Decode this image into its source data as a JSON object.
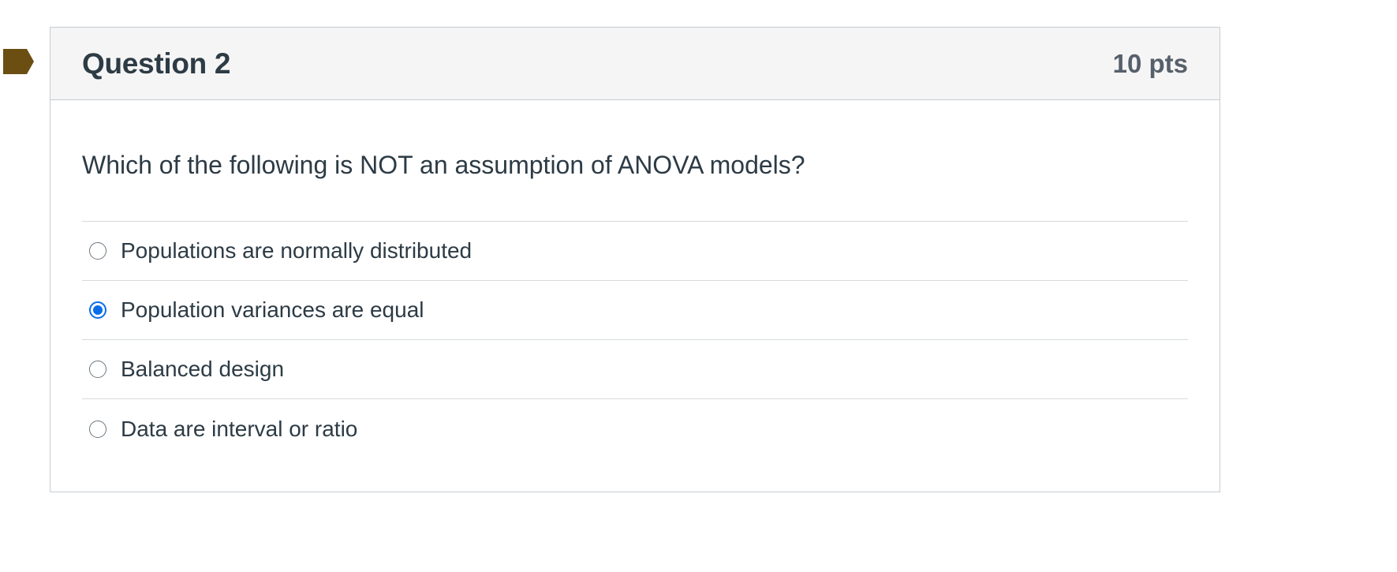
{
  "question": {
    "title": "Question 2",
    "points": "10 pts",
    "text": "Which of the following is NOT an assumption of ANOVA models?",
    "flag_icon": "flag-icon",
    "flag_color": "#6b4e12",
    "selected_index": 1,
    "answers": [
      {
        "label": "Populations are normally distributed",
        "selected": false
      },
      {
        "label": "Population variances are equal",
        "selected": true
      },
      {
        "label": "Balanced design",
        "selected": false
      },
      {
        "label": "Data are interval or ratio",
        "selected": false
      }
    ]
  },
  "colors": {
    "header_bg": "#f5f5f5",
    "border": "#c7cdd1",
    "text": "#2d3b45",
    "accent": "#0b6ee8"
  }
}
